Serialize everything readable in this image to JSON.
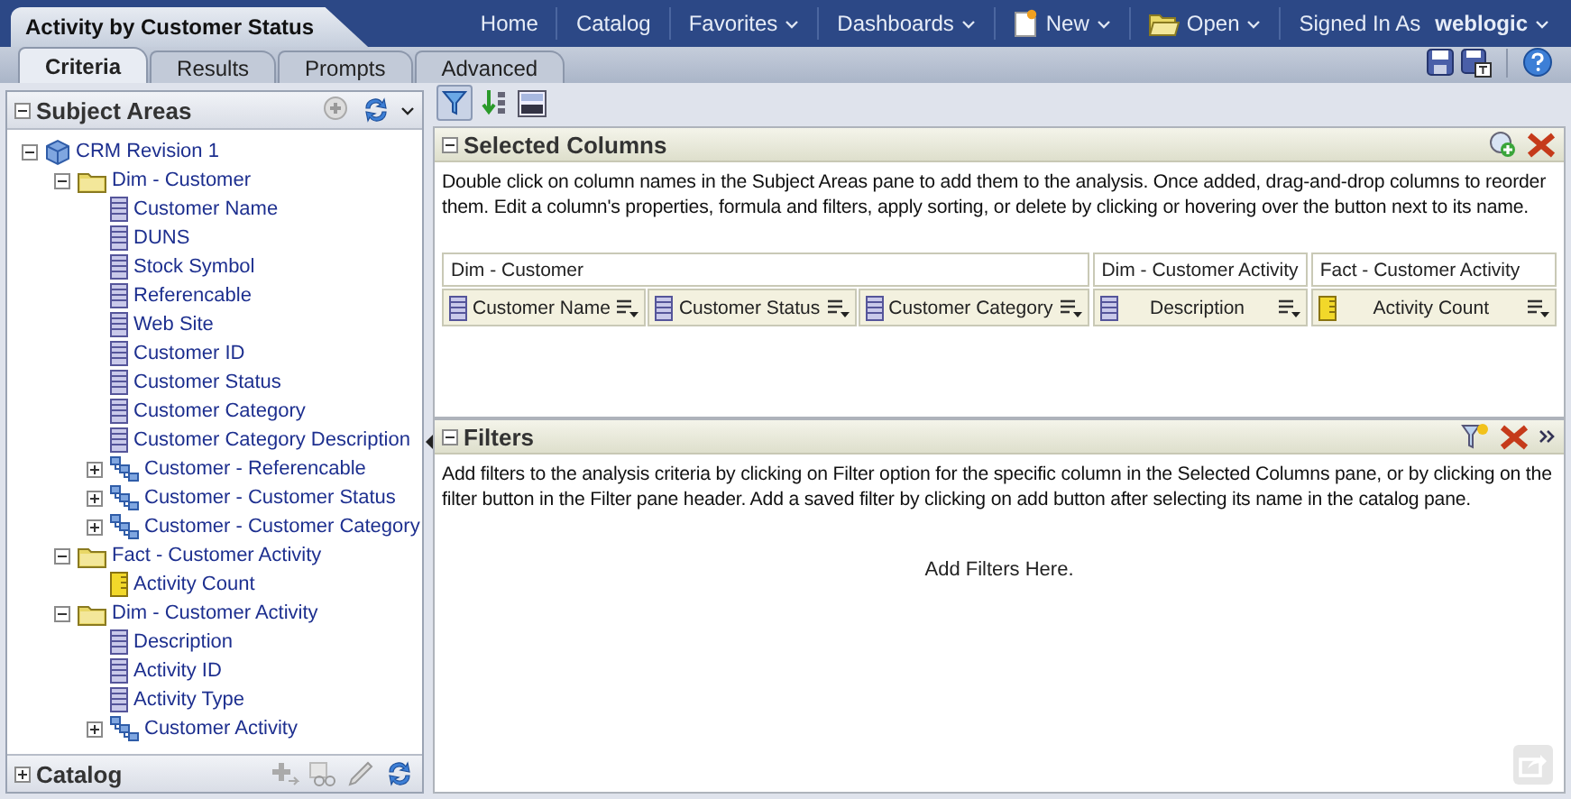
{
  "document_tab": {
    "title": "Activity by Customer Status"
  },
  "global_menu": [
    {
      "label": "Home",
      "kind": "link"
    },
    {
      "label": "Catalog",
      "kind": "link"
    },
    {
      "label": "Favorites",
      "kind": "menu"
    },
    {
      "label": "Dashboards",
      "kind": "menu"
    },
    {
      "label": "New",
      "kind": "new"
    },
    {
      "label": "Open",
      "kind": "open"
    }
  ],
  "user": {
    "label": "Signed In As",
    "name": "weblogic"
  },
  "tabs": [
    {
      "label": "Criteria",
      "selected": true
    },
    {
      "label": "Results",
      "selected": false
    },
    {
      "label": "Prompts",
      "selected": false
    },
    {
      "label": "Advanced",
      "selected": false
    }
  ],
  "subject_areas": {
    "title": "Subject Areas",
    "expanded": true,
    "tree": [
      {
        "label": "CRM Revision 1",
        "kind": "subject-area",
        "expanded": true,
        "children": [
          {
            "label": "Dim - Customer",
            "kind": "folder",
            "expanded": true,
            "children": [
              {
                "label": "Customer Name",
                "kind": "column"
              },
              {
                "label": "DUNS",
                "kind": "column"
              },
              {
                "label": "Stock Symbol",
                "kind": "column"
              },
              {
                "label": "Referencable",
                "kind": "column"
              },
              {
                "label": "Web Site",
                "kind": "column"
              },
              {
                "label": "Customer ID",
                "kind": "column"
              },
              {
                "label": "Customer Status",
                "kind": "column"
              },
              {
                "label": "Customer Category",
                "kind": "column"
              },
              {
                "label": "Customer Category Description",
                "kind": "column"
              },
              {
                "label": "Customer - Referencable",
                "kind": "hierarchy",
                "expanded": false
              },
              {
                "label": "Customer - Customer Status",
                "kind": "hierarchy",
                "expanded": false
              },
              {
                "label": "Customer - Customer Category",
                "kind": "hierarchy",
                "expanded": false
              }
            ]
          },
          {
            "label": "Fact - Customer Activity",
            "kind": "folder",
            "expanded": true,
            "children": [
              {
                "label": "Activity Count",
                "kind": "measure"
              }
            ]
          },
          {
            "label": "Dim - Customer Activity",
            "kind": "folder",
            "expanded": true,
            "children": [
              {
                "label": "Description",
                "kind": "column"
              },
              {
                "label": "Activity ID",
                "kind": "column"
              },
              {
                "label": "Activity Type",
                "kind": "column"
              },
              {
                "label": "Customer Activity",
                "kind": "hierarchy",
                "expanded": false
              }
            ]
          }
        ]
      }
    ]
  },
  "catalog": {
    "title": "Catalog",
    "expanded": false
  },
  "selected_columns": {
    "title": "Selected Columns",
    "expanded": true,
    "description": "Double click on column names in the Subject Areas pane to add them to the analysis. Once added, drag-and-drop columns to reorder them. Edit a column's properties, formula and filters, apply sorting, or delete by clicking or hovering over the button next to its name.",
    "groups": [
      {
        "name": "Dim - Customer",
        "columns": [
          {
            "name": "Customer Name",
            "kind": "attribute"
          },
          {
            "name": "Customer Status",
            "kind": "attribute"
          },
          {
            "name": "Customer Category",
            "kind": "attribute"
          }
        ]
      },
      {
        "name": "Dim - Customer Activity",
        "columns": [
          {
            "name": "Description",
            "kind": "attribute"
          }
        ]
      },
      {
        "name": "Fact - Customer Activity",
        "columns": [
          {
            "name": "Activity Count",
            "kind": "measure"
          }
        ]
      }
    ]
  },
  "filters": {
    "title": "Filters",
    "expanded": true,
    "description": "Add filters to the analysis criteria by clicking on Filter option for the specific column in the Selected Columns pane, or by clicking on the filter button in the Filter pane header. Add a saved filter by clicking on add button after selecting its name in the catalog pane.",
    "empty_text": "Add Filters Here."
  }
}
